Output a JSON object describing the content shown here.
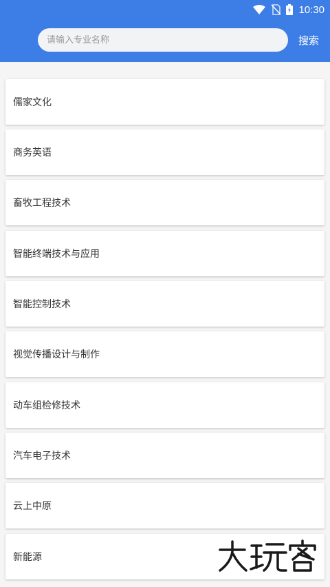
{
  "status_bar": {
    "time": "10:30"
  },
  "search": {
    "placeholder": "请输入专业名称",
    "button_label": "搜索"
  },
  "majors": [
    "儒家文化",
    "商务英语",
    "畜牧工程技术",
    "智能终端技术与应用",
    "智能控制技术",
    "视觉传播设计与制作",
    "动车组检修技术",
    "汽车电子技术",
    "云上中原",
    "新能源"
  ],
  "watermark": {
    "text": "大玩客"
  },
  "colors": {
    "header": "#3d7de6",
    "list_background": "#f5f5f5",
    "card": "#ffffff",
    "text": "#333333"
  }
}
